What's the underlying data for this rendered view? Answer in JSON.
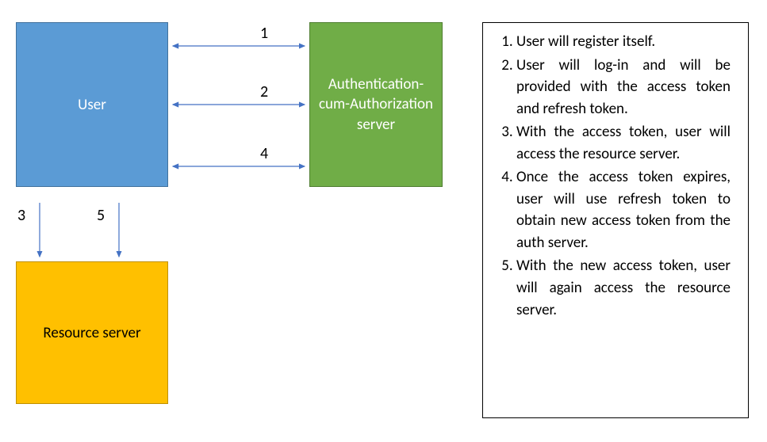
{
  "boxes": {
    "user": "User",
    "auth": "Authentication-cum-Authorization server",
    "resource": "Resource server"
  },
  "arrow_labels": {
    "a1": "1",
    "a2": "2",
    "a4": "4",
    "a3": "3",
    "a5": "5"
  },
  "steps": {
    "s1": "User will register itself.",
    "s2": "User will log-in and will be provided with the access token and refresh token.",
    "s3": "With the access token, user will access the resource server.",
    "s4": "Once the access token expires, user will use refresh token to obtain new access token from the auth server.",
    "s5": "With the new access token, user will again access the resource server."
  },
  "colors": {
    "user_fill": "#5b9bd5",
    "auth_fill": "#70ad47",
    "resource_fill": "#ffc000",
    "arrow_stroke": "#4472c4"
  }
}
